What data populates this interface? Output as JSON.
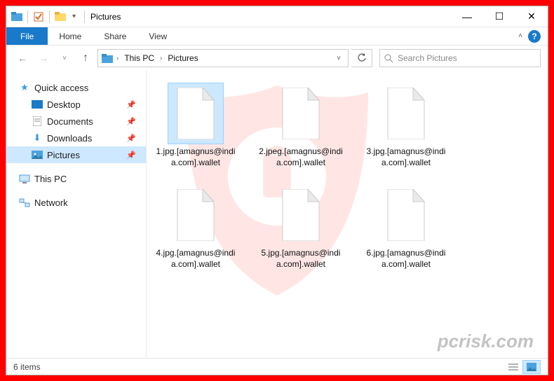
{
  "window": {
    "title": "Pictures",
    "controls": {
      "min": "—",
      "max": "☐",
      "close": "✕"
    }
  },
  "ribbon": {
    "file": "File",
    "tabs": [
      "Home",
      "Share",
      "View"
    ]
  },
  "breadcrumb": {
    "segments": [
      "This PC",
      "Pictures"
    ]
  },
  "search": {
    "placeholder": "Search Pictures"
  },
  "sidebar": {
    "quick_access": "Quick access",
    "items": [
      {
        "label": "Desktop",
        "pinned": true
      },
      {
        "label": "Documents",
        "pinned": true
      },
      {
        "label": "Downloads",
        "pinned": true
      },
      {
        "label": "Pictures",
        "pinned": true,
        "selected": true
      }
    ],
    "this_pc": "This PC",
    "network": "Network"
  },
  "files": [
    {
      "name": "1.jpg.[amagnus@india.com].wallet",
      "selected": true
    },
    {
      "name": "2.jpeg.[amagnus@india.com].wallet"
    },
    {
      "name": "3.jpg.[amagnus@india.com].wallet"
    },
    {
      "name": "4.jpg.[amagnus@india.com].wallet"
    },
    {
      "name": "5.jpg.[amagnus@india.com].wallet"
    },
    {
      "name": "6.jpg.[amagnus@india.com].wallet"
    }
  ],
  "statusbar": {
    "count": "6 items"
  },
  "watermark": "pcrisk.com"
}
